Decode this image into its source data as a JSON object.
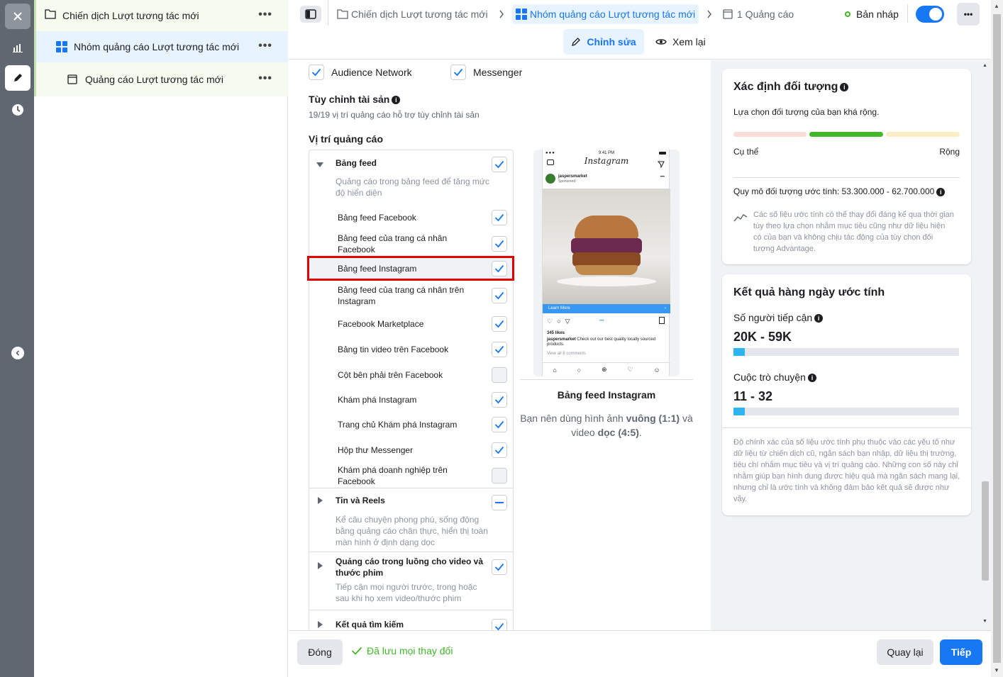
{
  "tree": {
    "campaign": "Chiến dịch Lượt tương tác mới",
    "adset": "Nhóm quảng cáo Lượt tương tác mới",
    "ad": "Quảng cáo Lượt tương tác mới",
    "more": "•••"
  },
  "breadcrumb": {
    "campaign": "Chiến dịch Lượt tương tác mới",
    "adset": "Nhóm quảng cáo Lượt tương tác mới",
    "ads": "1 Quảng cáo",
    "status": "Bản nháp",
    "more": "•••"
  },
  "tabs": {
    "edit": "Chỉnh sửa",
    "review": "Xem lại"
  },
  "platforms": {
    "audience_network": "Audience Network",
    "messenger": "Messenger"
  },
  "asset_custom": {
    "title": "Tùy chỉnh tài sản",
    "subtitle": "19/19 vị trí quảng cáo hỗ trợ tùy chỉnh tài sản"
  },
  "placements": {
    "title": "Vị trí quảng cáo",
    "feeds": {
      "label": "Bảng feed",
      "desc": "Quảng cáo trong bảng feed để tăng mức độ hiển diện",
      "items": [
        {
          "label": "Bảng feed Facebook",
          "checked": true
        },
        {
          "label": "Bảng feed của trang cá nhân Facebook",
          "checked": true
        },
        {
          "label": "Bảng feed Instagram",
          "checked": true
        },
        {
          "label": "Bảng feed của trang cá nhân trên Instagram",
          "checked": true
        },
        {
          "label": "Facebook Marketplace",
          "checked": true
        },
        {
          "label": "Bảng tin video trên Facebook",
          "checked": true
        },
        {
          "label": "Cột bên phải trên Facebook",
          "checked": false
        },
        {
          "label": "Khám phá Instagram",
          "checked": true
        },
        {
          "label": "Trang chủ Khám phá Instagram",
          "checked": true
        },
        {
          "label": "Hộp thư Messenger",
          "checked": true
        },
        {
          "label": "Khám phá doanh nghiệp trên Facebook",
          "checked": false
        }
      ]
    },
    "stories": {
      "label": "Tin và Reels",
      "desc": "Kể câu chuyện phong phú, sống động bằng quảng cáo chân thực, hiển thị toàn màn hình ở định dạng dọc"
    },
    "instream": {
      "label": "Quảng cáo trong luồng cho video và thước phim",
      "desc": "Tiếp cận mọi người trước, trong hoặc sau khi họ xem video/thước phim"
    },
    "search": {
      "label": "Kết quả tìm kiếm"
    }
  },
  "preview": {
    "time": "9:41 PM",
    "app": "Instagram",
    "account": "jaspersmarket",
    "sponsored": "Sponsored",
    "cta": "Learn More",
    "likes": "345 likes",
    "caption_user": "jaspersmarket",
    "caption": "Check out our best quality locally sourced products.",
    "comments": "View all 8 comments",
    "title": "Bảng feed Instagram",
    "rec_prefix": "Bạn nên dùng hình ảnh ",
    "rec_square": "vuông (1:1)",
    "rec_mid": " và video ",
    "rec_vertical": "dọc (4:5)",
    "rec_end": "."
  },
  "audience": {
    "title": "Xác định đối tượng",
    "desc": "Lựa chọn đối tượng của bạn khá rộng.",
    "specific": "Cụ thể",
    "broad": "Rộng",
    "size": "Quy mô đối tượng ước tính: 53.300.000 - 62.700.000",
    "note": "Các số liệu ước tính có thể thay đổi đáng kể qua thời gian tùy theo lựa chọn nhắm mục tiêu cũng như dữ liệu hiện có của bạn và không chịu tác động của tùy chọn đối tượng Advantage."
  },
  "daily": {
    "title": "Kết quả hàng ngày ước tính",
    "reach_label": "Số người tiếp cận",
    "reach": "20K - 59K",
    "reach_level": 0.05,
    "conv_label": "Cuộc trò chuyện",
    "conv": "11 - 32",
    "conv_level": 0.05,
    "disclaimer": "Độ chính xác của số liệu ước tính phụ thuộc vào các yếu tố như dữ liệu từ chiến dịch cũ, ngân sách bạn nhập, dữ liệu thị trường, tiêu chí nhắm mục tiêu và vị trí quảng cáo. Những con số này chỉ nhằm giúp bạn hình dung được hiệu quả mà ngân sách mang lại, nhưng chỉ là ước tính và không đảm bảo kết quả sẽ được như vậy."
  },
  "footer": {
    "close": "Đóng",
    "saved": "Đã lưu mọi thay đổi",
    "back": "Quay lại",
    "next": "Tiếp"
  },
  "colors": {
    "accent": "#1877f2",
    "highlight": "#e50000",
    "green": "#42b72a"
  }
}
